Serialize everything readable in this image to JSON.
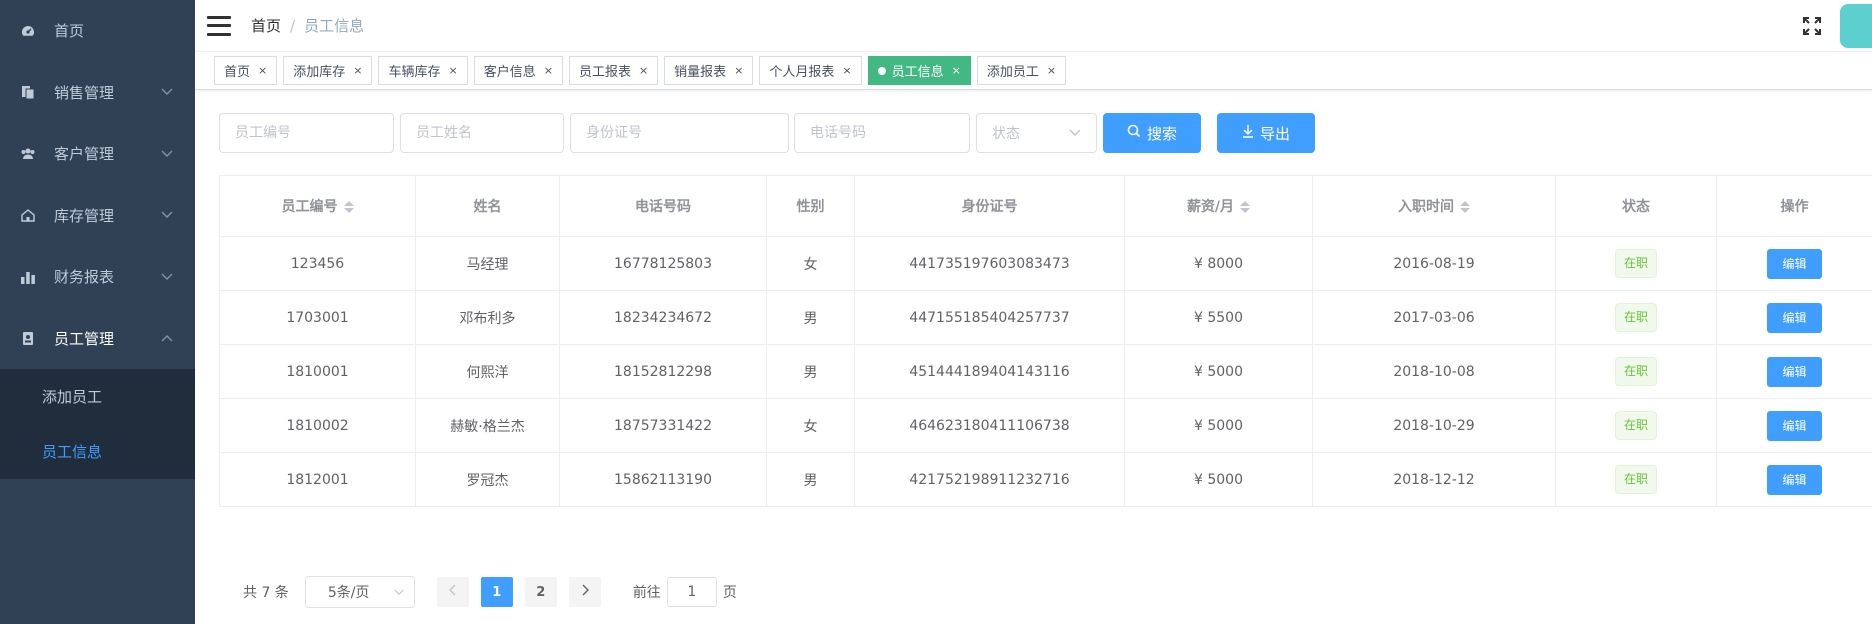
{
  "sidebar": {
    "items": [
      {
        "label": "首页",
        "icon": "dashboard-icon"
      },
      {
        "label": "销售管理",
        "icon": "document-icon"
      },
      {
        "label": "客户管理",
        "icon": "people-icon"
      },
      {
        "label": "库存管理",
        "icon": "home-icon"
      },
      {
        "label": "财务报表",
        "icon": "bar-chart-icon"
      },
      {
        "label": "员工管理",
        "icon": "badge-icon"
      }
    ],
    "submenu": [
      {
        "label": "添加员工"
      },
      {
        "label": "员工信息"
      }
    ]
  },
  "navbar": {
    "breadcrumb_home": "首页",
    "breadcrumb_sep": "/",
    "breadcrumb_current": "员工信息"
  },
  "tags": [
    {
      "label": "首页",
      "close": "×"
    },
    {
      "label": "添加库存",
      "close": "×"
    },
    {
      "label": "车辆库存",
      "close": "×"
    },
    {
      "label": "客户信息",
      "close": "×"
    },
    {
      "label": "员工报表",
      "close": "×"
    },
    {
      "label": "销量报表",
      "close": "×"
    },
    {
      "label": "个人月报表",
      "close": "×"
    },
    {
      "label": "员工信息",
      "close": "×"
    },
    {
      "label": "添加员工",
      "close": "×"
    }
  ],
  "filters": {
    "emp_id_placeholder": "员工编号",
    "emp_name_placeholder": "员工姓名",
    "id_card_placeholder": "身份证号",
    "phone_placeholder": "电话号码",
    "status_placeholder": "状态",
    "search_label": "搜索",
    "export_label": "导出"
  },
  "table": {
    "headers": [
      "员工编号",
      "姓名",
      "电话号码",
      "性别",
      "身份证号",
      "薪资/月",
      "入职时间",
      "状态",
      "操作"
    ],
    "rows": [
      {
        "id": "123456",
        "name": "马经理",
        "phone": "16778125803",
        "gender": "女",
        "id_card": "441735197603083473",
        "salary": "¥ 8000",
        "date": "2016-08-19",
        "status": "在职",
        "action": "编辑"
      },
      {
        "id": "1703001",
        "name": "邓布利多",
        "phone": "18234234672",
        "gender": "男",
        "id_card": "447155185404257737",
        "salary": "¥ 5500",
        "date": "2017-03-06",
        "status": "在职",
        "action": "编辑"
      },
      {
        "id": "1810001",
        "name": "何熙洋",
        "phone": "18152812298",
        "gender": "男",
        "id_card": "451444189404143116",
        "salary": "¥ 5000",
        "date": "2018-10-08",
        "status": "在职",
        "action": "编辑"
      },
      {
        "id": "1810002",
        "name": "赫敏·格兰杰",
        "phone": "18757331422",
        "gender": "女",
        "id_card": "464623180411106738",
        "salary": "¥ 5000",
        "date": "2018-10-29",
        "status": "在职",
        "action": "编辑"
      },
      {
        "id": "1812001",
        "name": "罗冠杰",
        "phone": "15862113190",
        "gender": "男",
        "id_card": "421752198911232716",
        "salary": "¥ 5000",
        "date": "2018-12-12",
        "status": "在职",
        "action": "编辑"
      }
    ]
  },
  "pagination": {
    "total": "共 7 条",
    "page_size": "5条/页",
    "pages": [
      "1",
      "2"
    ],
    "goto_prefix": "前往",
    "goto_value": "1",
    "goto_suffix": "页"
  },
  "colors": {
    "sidebar_bg": "#304156",
    "primary": "#409eff",
    "active_tag": "#42b983",
    "status_green": "#67c23a"
  }
}
